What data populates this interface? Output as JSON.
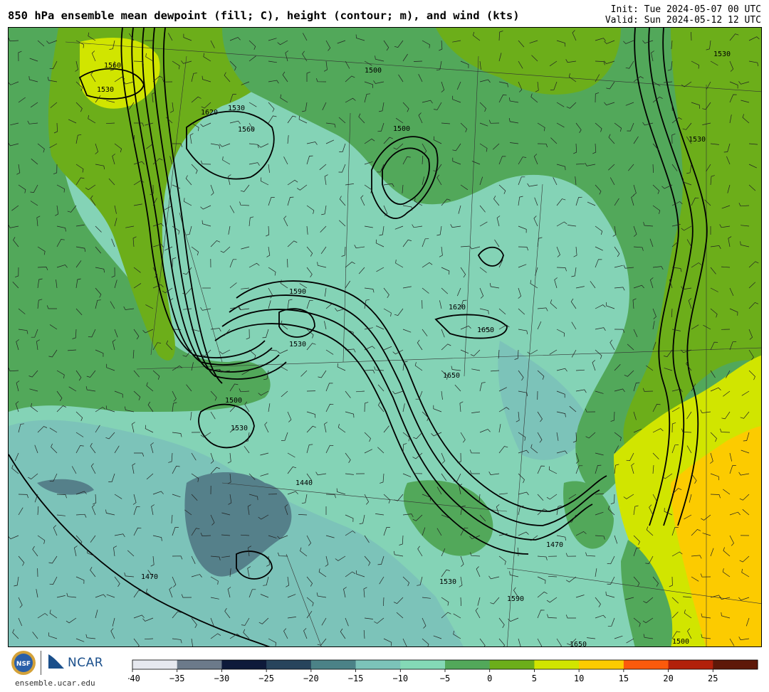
{
  "header": {
    "title": "850 hPa ensemble mean dewpoint (fill; C), height (contour; m), and wind (kts)",
    "init": "Init: Tue 2024-05-07 00 UTC",
    "valid": "Valid: Sun 2024-05-12 12 UTC"
  },
  "footer": {
    "org_label": "NCAR",
    "site": "ensemble.ucar.edu"
  },
  "colorbar": {
    "ticks": [
      "−40",
      "−35",
      "−30",
      "−25",
      "−20",
      "−15",
      "−10",
      "−5",
      "0",
      "5",
      "10",
      "15",
      "20",
      "25"
    ],
    "colors": [
      "#e6e8ef",
      "#6c7a8a",
      "#0e1a3a",
      "#27445c",
      "#4b8287",
      "#7cc3b9",
      "#84d9b6",
      "#52a85a",
      "#6cae1a",
      "#d1e500",
      "#fccb00",
      "#fb5a0c",
      "#b2200a",
      "#5e1808"
    ]
  },
  "contour_labels": [
    "1530",
    "1560",
    "1620",
    "1650",
    "1500",
    "1590",
    "1470",
    "1440"
  ],
  "map": {
    "colors": {
      "teal_dark": "#4b8287",
      "teal": "#7cc3b9",
      "mint": "#84d3b6",
      "green": "#52a85a",
      "olive": "#6cae1a",
      "yellow": "#d1e500",
      "orange": "#fccb00",
      "slate": "#55808a"
    }
  }
}
